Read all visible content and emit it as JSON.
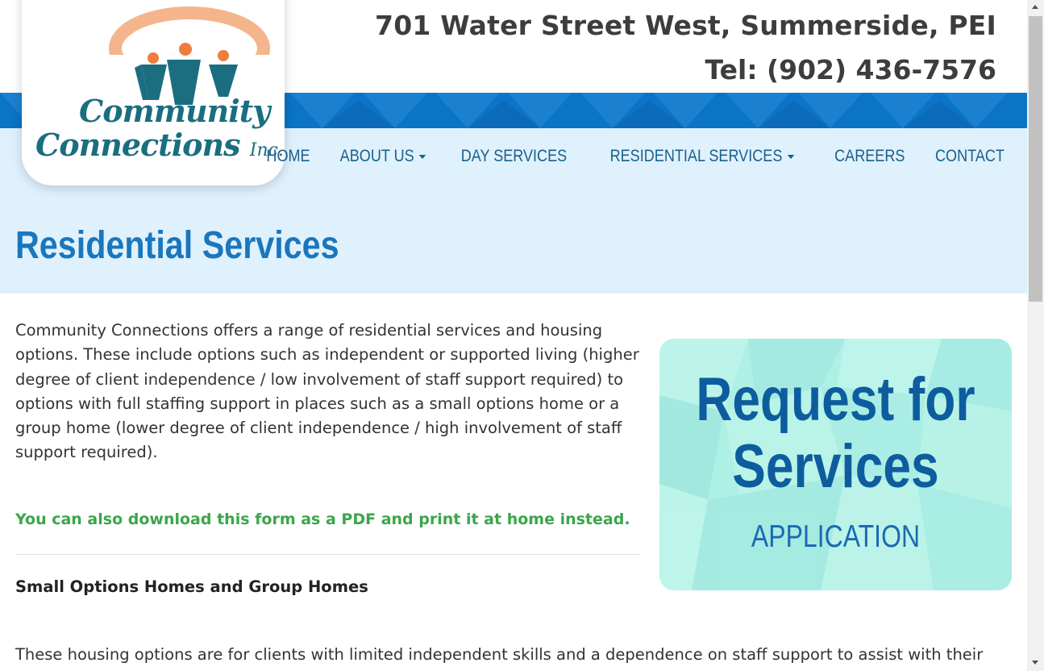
{
  "header": {
    "address": "701 Water Street West, Summerside, PEI",
    "phone": "Tel: (902) 436-7576"
  },
  "logo": {
    "line1": "Community",
    "line2": "Connections",
    "suffix": "Inc.",
    "icon": "community-people-icon"
  },
  "nav": {
    "items": [
      {
        "label": "HOME",
        "has_dropdown": false
      },
      {
        "label": "ABOUT US",
        "has_dropdown": true
      },
      {
        "label": "DAY SERVICES",
        "has_dropdown": false
      },
      {
        "label": "RESIDENTIAL SERVICES",
        "has_dropdown": true
      },
      {
        "label": "CAREERS",
        "has_dropdown": false
      },
      {
        "label": "CONTACT",
        "has_dropdown": false
      }
    ]
  },
  "page": {
    "title": "Residential Services",
    "intro": "Community Connections offers a range of residential services and housing options. These include options such as independent or supported living (higher degree of client independence / low involvement of staff support required) to options with full staffing support in places such as a small options home or a group home (lower degree of client independence / high involvement of staff support required).",
    "download_link": "You can also download this form as a PDF and print it at home instead.",
    "subheading": "Small Options Homes and Group Homes",
    "paragraph2": "These housing options are for clients with limited independent skills and a dependence on staff support to assist with their"
  },
  "request_card": {
    "line1": "Request for",
    "line2": "Services",
    "line3": "APPLICATION"
  },
  "colors": {
    "brand_blue": "#0a74c7",
    "hero_bg": "#dff1fd",
    "nav_text": "#1a5f8a",
    "title_blue": "#1b76bc",
    "link_green": "#3aa64a",
    "logo_teal": "#1b6e80",
    "logo_orange": "#f08a4b"
  }
}
